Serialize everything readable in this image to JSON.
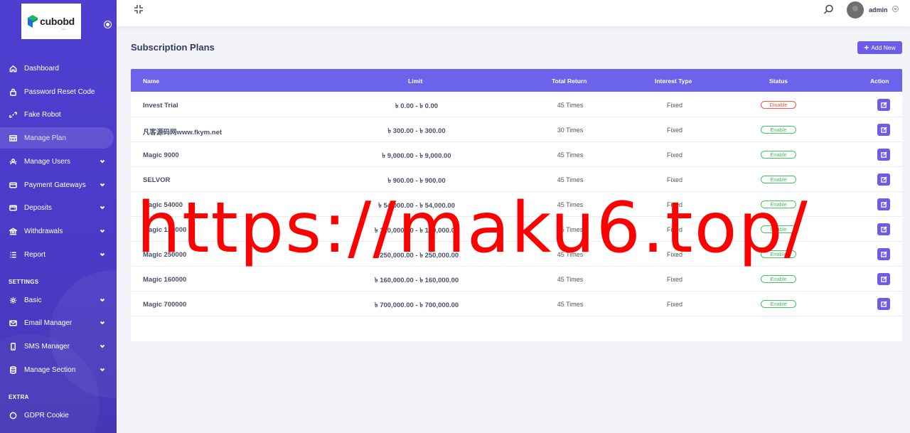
{
  "brand": {
    "logo_text": "cubobd",
    "logo_sub": "com"
  },
  "sidebar": {
    "items": [
      {
        "label": "Dashboard",
        "icon": "home-icon",
        "has_chevron": false,
        "active": false
      },
      {
        "label": "Password Reset Code",
        "icon": "lock-icon",
        "has_chevron": false,
        "active": false
      },
      {
        "label": "Fake Robot",
        "icon": "link-icon",
        "has_chevron": false,
        "active": false
      },
      {
        "label": "Manage Plan",
        "icon": "columns-icon",
        "has_chevron": false,
        "active": true
      },
      {
        "label": "Manage Users",
        "icon": "users-icon",
        "has_chevron": true,
        "active": false
      },
      {
        "label": "Payment Gateways",
        "icon": "credit-card-icon",
        "has_chevron": true,
        "active": false
      },
      {
        "label": "Deposits",
        "icon": "wallet-icon",
        "has_chevron": true,
        "active": false
      },
      {
        "label": "Withdrawals",
        "icon": "bank-icon",
        "has_chevron": true,
        "active": false
      },
      {
        "label": "Report",
        "icon": "list-icon",
        "has_chevron": true,
        "active": false
      },
      {
        "label": "Basic",
        "icon": "gear-icon",
        "has_chevron": true,
        "active": false
      },
      {
        "label": "Email Manager",
        "icon": "envelope-icon",
        "has_chevron": true,
        "active": false
      },
      {
        "label": "SMS Manager",
        "icon": "mobile-icon",
        "has_chevron": true,
        "active": false
      },
      {
        "label": "Manage Section",
        "icon": "database-icon",
        "has_chevron": true,
        "active": false
      },
      {
        "label": "GDPR Cookie",
        "icon": "cookie-icon",
        "has_chevron": false,
        "active": false
      }
    ],
    "sections": {
      "settings": "SETTINGS",
      "extra": "EXTRA"
    }
  },
  "topbar": {
    "user_name": "admin"
  },
  "page": {
    "title": "Subscription Plans",
    "add_button": "Add New"
  },
  "table": {
    "headers": {
      "name": "Name",
      "limit": "Limit",
      "total_return": "Total Return",
      "interest_type": "Interest Type",
      "status": "Status",
      "action": "Action"
    },
    "rows": [
      {
        "name": "Invest Trial",
        "limit": "৳ 0.00 - ৳ 0.00",
        "total_return": "45 Times",
        "interest_type": "Fixed",
        "status": "Disable"
      },
      {
        "name": "凡客源码网www.fkym.net",
        "limit": "৳ 300.00 - ৳ 300.00",
        "total_return": "30 Times",
        "interest_type": "Fixed",
        "status": "Enable"
      },
      {
        "name": "Magic 9000",
        "limit": "৳ 9,000.00 - ৳ 9,000.00",
        "total_return": "45 Times",
        "interest_type": "Fixed",
        "status": "Enable"
      },
      {
        "name": "SELVOR",
        "limit": "৳ 900.00 - ৳ 900.00",
        "total_return": "45 Times",
        "interest_type": "Fixed",
        "status": "Enable"
      },
      {
        "name": "Magic 54000",
        "limit": "৳ 54,000.00 - ৳ 54,000.00",
        "total_return": "45 Times",
        "interest_type": "Fixed",
        "status": "Enable"
      },
      {
        "name": "Magic 120000",
        "limit": "৳ 120,000.00 - ৳ 120,000.00",
        "total_return": "45 Times",
        "interest_type": "Fixed",
        "status": "Enable"
      },
      {
        "name": "Magic 250000",
        "limit": "৳ 250,000.00 - ৳ 250,000.00",
        "total_return": "45 Times",
        "interest_type": "Fixed",
        "status": "Enable"
      },
      {
        "name": "Magic 160000",
        "limit": "৳ 160,000.00 - ৳ 160,000.00",
        "total_return": "45 Times",
        "interest_type": "Fixed",
        "status": "Enable"
      },
      {
        "name": "Magic 700000",
        "limit": "৳ 700,000.00 - ৳ 700,000.00",
        "total_return": "45 Times",
        "interest_type": "Fixed",
        "status": "Enable"
      }
    ]
  },
  "watermark": "https://maku6.top/",
  "colors": {
    "sidebar": "#4f3fd1",
    "accent": "#6c5ce7",
    "enable": "#47c363",
    "disable": "#fc544b",
    "watermark": "#ff0000"
  }
}
